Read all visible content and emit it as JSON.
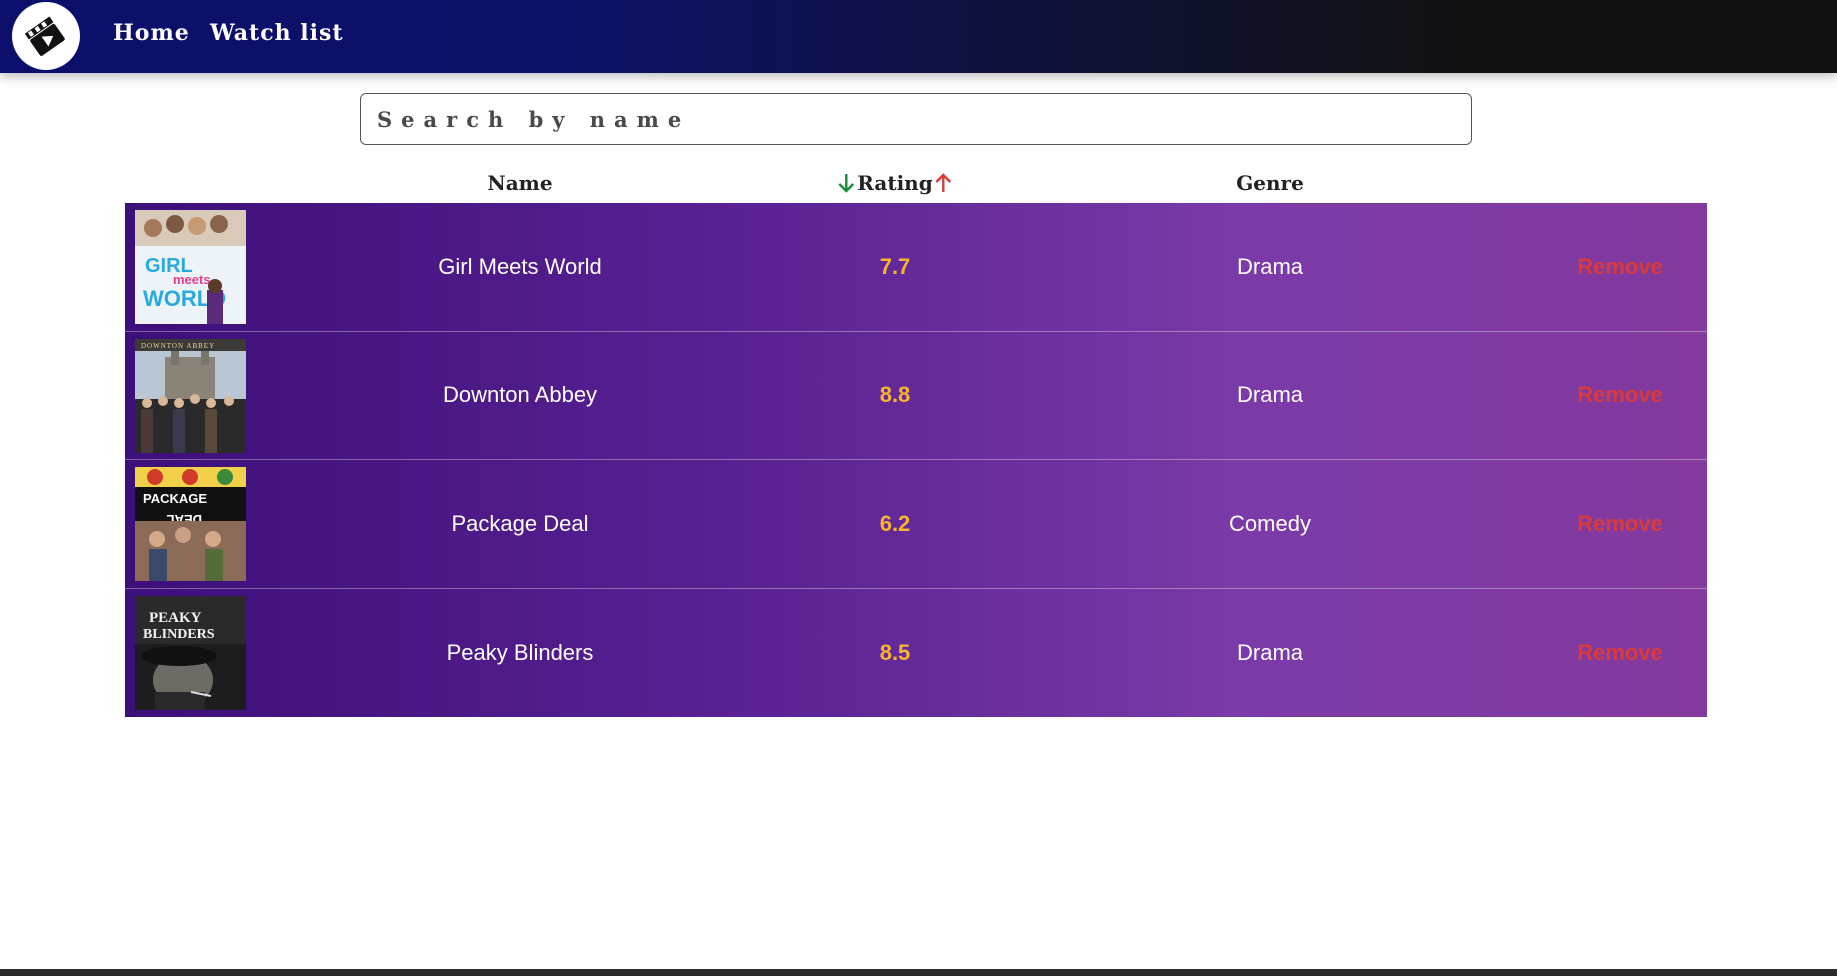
{
  "nav": {
    "logo_icon": "film-clapper-icon",
    "links": [
      "Home",
      "Watch list"
    ]
  },
  "search": {
    "placeholder": "Search by name",
    "value": ""
  },
  "table": {
    "headers": {
      "name": "Name",
      "rating": "Rating",
      "genre": "Genre"
    },
    "sort_icons": {
      "down": "arrow-down-icon",
      "up": "arrow-up-icon"
    },
    "rows": [
      {
        "name": "Girl Meets World",
        "rating": "7.7",
        "genre": "Drama",
        "action": "Remove",
        "poster_text": "GIRL meets WORLD"
      },
      {
        "name": "Downton Abbey",
        "rating": "8.8",
        "genre": "Drama",
        "action": "Remove",
        "poster_text": "DOWNTON ABBEY"
      },
      {
        "name": "Package Deal",
        "rating": "6.2",
        "genre": "Comedy",
        "action": "Remove",
        "poster_text": "PACKAGE DEAL"
      },
      {
        "name": "Peaky Blinders",
        "rating": "8.5",
        "genre": "Drama",
        "action": "Remove",
        "poster_text": "PEAKY BLINDERS"
      }
    ]
  },
  "colors": {
    "rating": "#f7b42c",
    "remove": "#d93a3a",
    "sort_down": "#1a8a3c",
    "sort_up": "#d93a3a"
  }
}
